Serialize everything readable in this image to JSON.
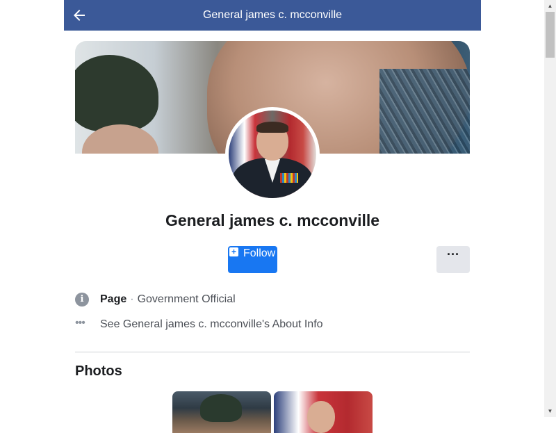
{
  "header": {
    "title": "General james c. mcconville"
  },
  "profile": {
    "name": "General james c. mcconville",
    "follow_label": "Follow",
    "follow_icon": "+",
    "more_label": "···"
  },
  "info": {
    "page_label": "Page",
    "separator": "·",
    "category": "Government Official",
    "about_link": "See General james c. mcconville's About Info",
    "info_glyph": "i",
    "dots_glyph": "•••"
  },
  "photos": {
    "title": "Photos"
  },
  "scrollbar": {
    "up": "▲",
    "down": "▼"
  },
  "colors": {
    "header_bg": "#3b5998",
    "follow_bg": "#1877f2",
    "more_bg": "#e4e6eb"
  }
}
